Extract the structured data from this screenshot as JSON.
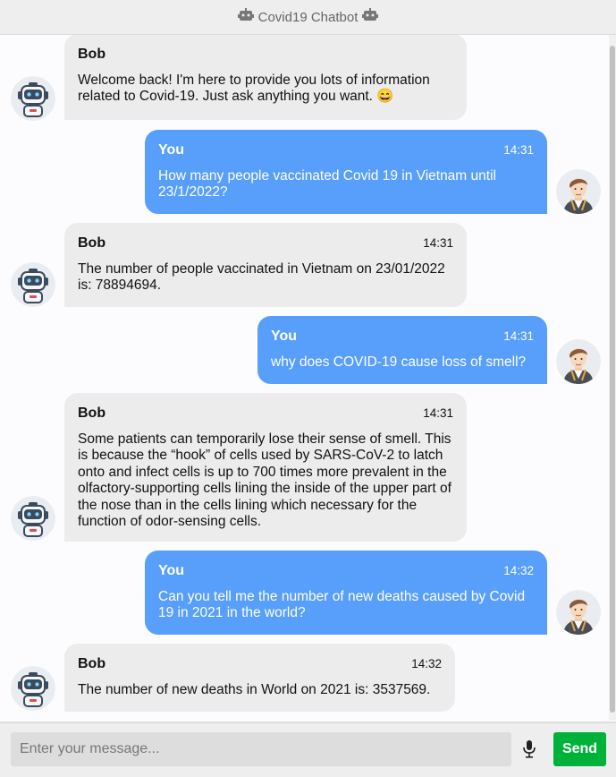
{
  "header": {
    "title": "Covid19 Chatbot"
  },
  "messages": [
    {
      "sender": "Bob",
      "time": "",
      "text": "Welcome back! I'm here to provide you lots of information related to Covid-19. Just ask anything you want. 😄"
    },
    {
      "sender": "You",
      "time": "14:31",
      "text": "How many people vaccinated Covid 19 in Vietnam until 23/1/2022?"
    },
    {
      "sender": "Bob",
      "time": "14:31",
      "text": "The number of people vaccinated in Vietnam on 23/01/2022 is: 78894694."
    },
    {
      "sender": "You",
      "time": "14:31",
      "text": "why does COVID-19 cause loss of smell?"
    },
    {
      "sender": "Bob",
      "time": "14:31",
      "text": "Some patients can temporarily lose their sense of smell. This is because the “hook” of cells used by SARS-CoV-2 to latch onto and infect cells is up to 700 times more prevalent in the olfactory-supporting cells lining the inside of the upper part of the nose than in the cells lining which necessary for the function of odor-sensing cells."
    },
    {
      "sender": "You",
      "time": "14:32",
      "text": "Can you tell me the number of new deaths caused by Covid 19 in 2021 in the world?"
    },
    {
      "sender": "Bob",
      "time": "14:32",
      "text": "The number of new deaths in World on 2021 is: 3537569."
    }
  ],
  "input": {
    "placeholder": "Enter your message..."
  },
  "send_label": "Send",
  "colors": {
    "user_bubble": "#579ffb",
    "bot_bubble": "#ececec",
    "send_button": "#00b23a"
  },
  "icons": {
    "bot_avatar": "robot-avatar-icon",
    "user_avatar": "user-avatar-icon",
    "mic": "microphone-icon"
  }
}
